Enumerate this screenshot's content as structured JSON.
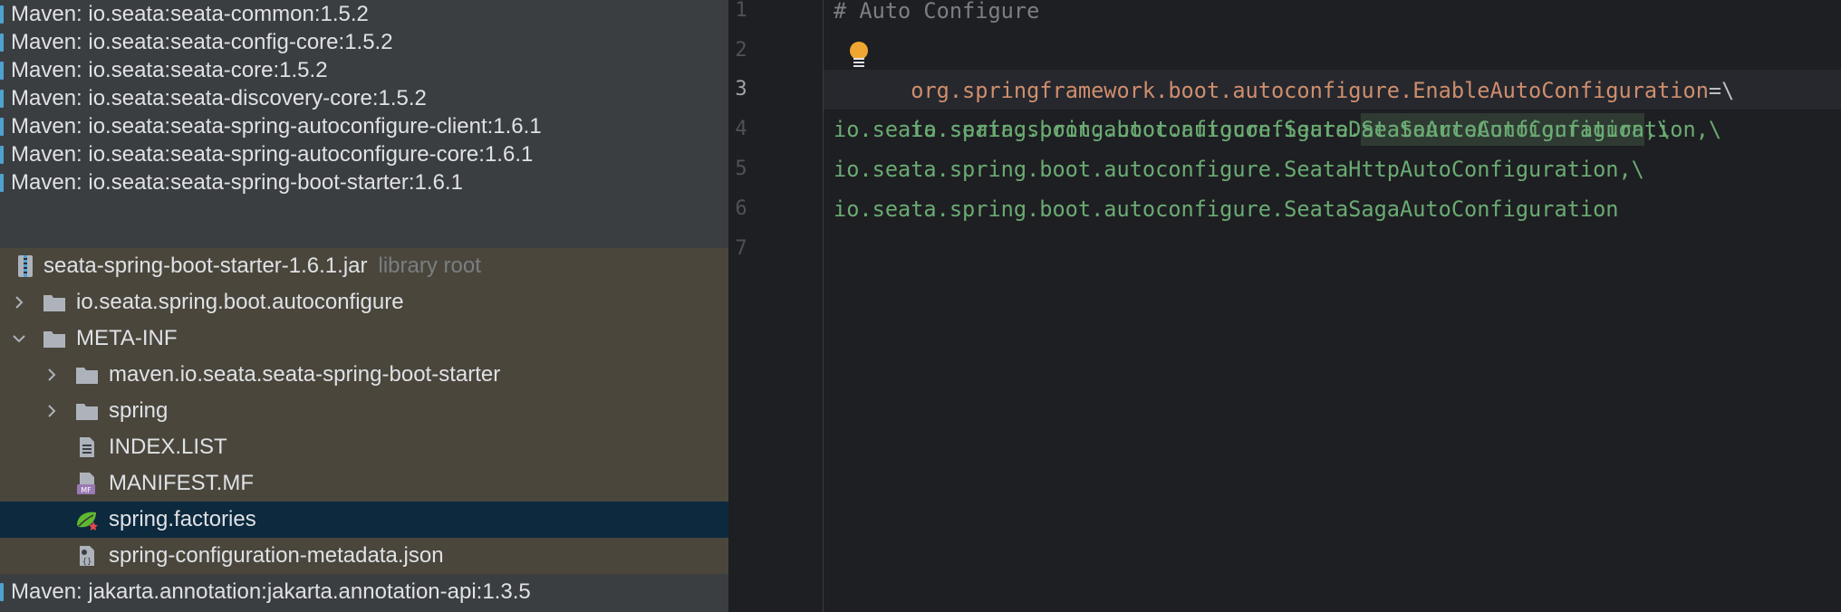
{
  "project_tree": {
    "rows": [
      {
        "label": "Maven: io.seata:seata-common:1.5.2"
      },
      {
        "label": "Maven: io.seata:seata-config-core:1.5.2"
      },
      {
        "label": "Maven: io.seata:seata-core:1.5.2"
      },
      {
        "label": "Maven: io.seata:seata-discovery-core:1.5.2"
      },
      {
        "label": "Maven: io.seata:seata-spring-autoconfigure-client:1.6.1"
      },
      {
        "label": "Maven: io.seata:seata-spring-autoconfigure-core:1.6.1"
      },
      {
        "label": "Maven: io.seata:seata-spring-boot-starter:1.6.1"
      },
      {
        "label": "seata-spring-boot-starter-1.6.1.jar",
        "hint": "library root"
      },
      {
        "label": "io.seata.spring.boot.autoconfigure"
      },
      {
        "label": "META-INF"
      },
      {
        "label": "maven.io.seata.seata-spring-boot-starter"
      },
      {
        "label": "spring"
      },
      {
        "label": "INDEX.LIST"
      },
      {
        "label": "MANIFEST.MF"
      },
      {
        "label": "spring.factories"
      },
      {
        "label": "spring-configuration-metadata.json"
      },
      {
        "label": "Maven: jakarta.annotation:jakarta.annotation-api:1.3.5"
      }
    ]
  },
  "editor": {
    "line_numbers": [
      "1",
      "2",
      "3",
      "4",
      "5",
      "6",
      "7"
    ],
    "current_line": "3",
    "lines": {
      "l1": "# Auto Configure",
      "l2_key": "org.springframework.boot.autoconfigure.EnableAutoConfiguration",
      "l2_eq": "=",
      "l2_tail": "\\",
      "l3_pre": "io.seata.spring.boot.autoconfigure.",
      "l3_hl": "SeataAutoConfiguration",
      "l3_tail": ",\\",
      "l4": "io.seata.spring.boot.autoconfigure.SeataDataSourceAutoConfiguration,\\",
      "l5": "io.seata.spring.boot.autoconfigure.SeataHttpAutoConfiguration,\\",
      "l6": "io.seata.spring.boot.autoconfigure.SeataSagaAutoConfiguration"
    }
  },
  "colors": {
    "tree_bg": "#3b3e41",
    "library_bg": "#4a463c",
    "selection_bg": "#0d293e",
    "editor_bg": "#1e1f22",
    "key_orange": "#cf8e6d",
    "value_green": "#6aab73",
    "comment_gray": "#7a7e85"
  }
}
